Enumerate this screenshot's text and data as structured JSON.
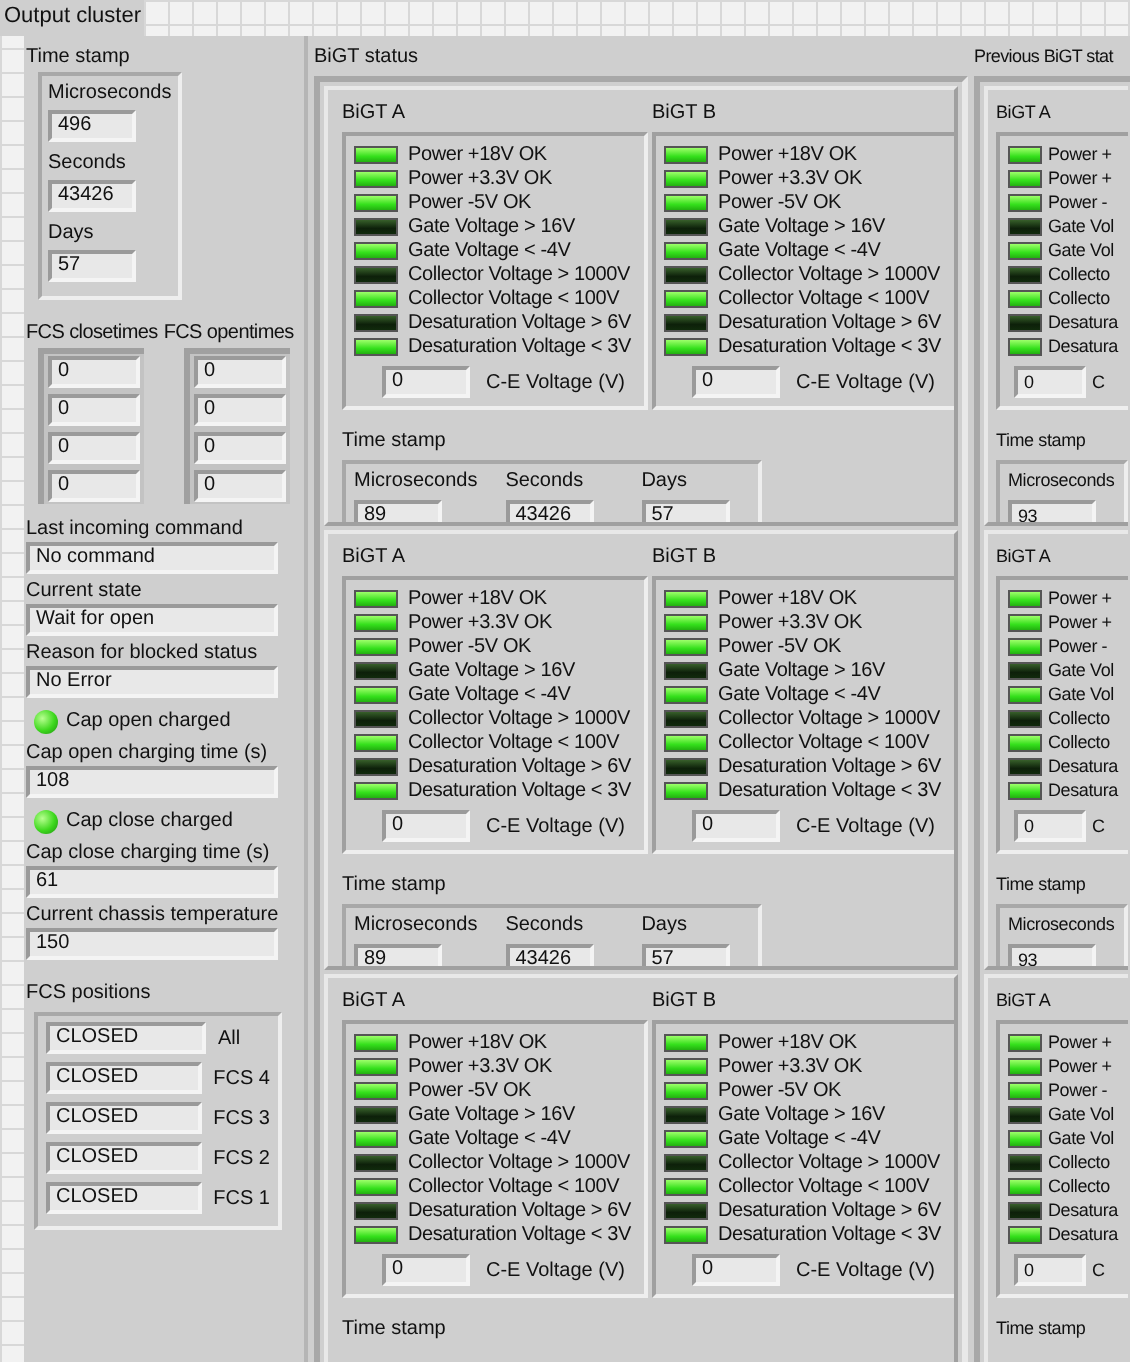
{
  "title": "Output cluster",
  "left": {
    "time_stamp": {
      "label": "Time stamp",
      "fields": [
        {
          "label": "Microseconds",
          "value": "496"
        },
        {
          "label": "Seconds",
          "value": "43426"
        },
        {
          "label": "Days",
          "value": "57"
        }
      ]
    },
    "arrays": [
      {
        "label": "FCS closetimes",
        "values": [
          "0",
          "0",
          "0",
          "0"
        ]
      },
      {
        "label": "FCS opentimes",
        "values": [
          "0",
          "0",
          "0",
          "0"
        ]
      }
    ],
    "indicators": [
      {
        "kind": "field",
        "label": "Last incoming command",
        "value": "No command"
      },
      {
        "kind": "field",
        "label": "Current state",
        "value": "Wait for open"
      },
      {
        "kind": "field",
        "label": "Reason for blocked status",
        "value": "No Error"
      },
      {
        "kind": "led",
        "label": "Cap open charged",
        "on": true
      },
      {
        "kind": "field",
        "label": "Cap open charging time (s)",
        "value": "108"
      },
      {
        "kind": "led",
        "label": "Cap close charged",
        "on": true
      },
      {
        "kind": "field",
        "label": "Cap close charging time (s)",
        "value": "61"
      },
      {
        "kind": "field",
        "label": "Current chassis temperature",
        "value": "150"
      }
    ],
    "fcs_positions": {
      "label": "FCS positions",
      "rows": [
        {
          "value": "CLOSED",
          "label": "All"
        },
        {
          "value": "CLOSED",
          "label": "FCS 4"
        },
        {
          "value": "CLOSED",
          "label": "FCS 3"
        },
        {
          "value": "CLOSED",
          "label": "FCS 2"
        },
        {
          "value": "CLOSED",
          "label": "FCS 1"
        }
      ]
    }
  },
  "bigt_status": {
    "title": "BiGT status",
    "blocks": [
      {
        "units": [
          {
            "title": "BiGT A",
            "leds": [
              {
                "label": "Power +18V OK",
                "on": true
              },
              {
                "label": "Power +3.3V OK",
                "on": true
              },
              {
                "label": "Power -5V OK",
                "on": true
              },
              {
                "label": "Gate Voltage > 16V",
                "on": false
              },
              {
                "label": "Gate Voltage < -4V",
                "on": true
              },
              {
                "label": "Collector Voltage > 1000V",
                "on": false
              },
              {
                "label": "Collector Voltage < 100V",
                "on": true
              },
              {
                "label": "Desaturation Voltage > 6V",
                "on": false
              },
              {
                "label": "Desaturation Voltage < 3V",
                "on": true
              }
            ],
            "ce_voltage": {
              "value": "0",
              "label": "C-E Voltage (V)"
            }
          },
          {
            "title": "BiGT B",
            "leds": [
              {
                "label": "Power +18V OK",
                "on": true
              },
              {
                "label": "Power +3.3V OK",
                "on": true
              },
              {
                "label": "Power -5V OK",
                "on": true
              },
              {
                "label": "Gate Voltage > 16V",
                "on": false
              },
              {
                "label": "Gate Voltage < -4V",
                "on": true
              },
              {
                "label": "Collector Voltage > 1000V",
                "on": false
              },
              {
                "label": "Collector Voltage < 100V",
                "on": true
              },
              {
                "label": "Desaturation Voltage > 6V",
                "on": false
              },
              {
                "label": "Desaturation Voltage < 3V",
                "on": true
              }
            ],
            "ce_voltage": {
              "value": "0",
              "label": "C-E Voltage (V)"
            }
          }
        ],
        "time_stamp": {
          "label": "Time stamp",
          "fields": [
            {
              "label": "Microseconds",
              "value": "89"
            },
            {
              "label": "Seconds",
              "value": "43426"
            },
            {
              "label": "Days",
              "value": "57"
            }
          ]
        }
      },
      {
        "units": [
          {
            "title": "BiGT A",
            "leds": [
              {
                "label": "Power +18V OK",
                "on": true
              },
              {
                "label": "Power +3.3V OK",
                "on": true
              },
              {
                "label": "Power -5V OK",
                "on": true
              },
              {
                "label": "Gate Voltage > 16V",
                "on": false
              },
              {
                "label": "Gate Voltage < -4V",
                "on": true
              },
              {
                "label": "Collector Voltage > 1000V",
                "on": false
              },
              {
                "label": "Collector Voltage < 100V",
                "on": true
              },
              {
                "label": "Desaturation Voltage > 6V",
                "on": false
              },
              {
                "label": "Desaturation Voltage < 3V",
                "on": true
              }
            ],
            "ce_voltage": {
              "value": "0",
              "label": "C-E Voltage (V)"
            }
          },
          {
            "title": "BiGT B",
            "leds": [
              {
                "label": "Power +18V OK",
                "on": true
              },
              {
                "label": "Power +3.3V OK",
                "on": true
              },
              {
                "label": "Power -5V OK",
                "on": true
              },
              {
                "label": "Gate Voltage > 16V",
                "on": false
              },
              {
                "label": "Gate Voltage < -4V",
                "on": true
              },
              {
                "label": "Collector Voltage > 1000V",
                "on": false
              },
              {
                "label": "Collector Voltage < 100V",
                "on": true
              },
              {
                "label": "Desaturation Voltage > 6V",
                "on": false
              },
              {
                "label": "Desaturation Voltage < 3V",
                "on": true
              }
            ],
            "ce_voltage": {
              "value": "0",
              "label": "C-E Voltage (V)"
            }
          }
        ],
        "time_stamp": {
          "label": "Time stamp",
          "fields": [
            {
              "label": "Microseconds",
              "value": "89"
            },
            {
              "label": "Seconds",
              "value": "43426"
            },
            {
              "label": "Days",
              "value": "57"
            }
          ]
        }
      },
      {
        "units": [
          {
            "title": "BiGT A",
            "leds": [
              {
                "label": "Power +18V OK",
                "on": true
              },
              {
                "label": "Power +3.3V OK",
                "on": true
              },
              {
                "label": "Power -5V OK",
                "on": true
              },
              {
                "label": "Gate Voltage > 16V",
                "on": false
              },
              {
                "label": "Gate Voltage < -4V",
                "on": true
              },
              {
                "label": "Collector Voltage > 1000V",
                "on": false
              },
              {
                "label": "Collector Voltage < 100V",
                "on": true
              },
              {
                "label": "Desaturation Voltage > 6V",
                "on": false
              },
              {
                "label": "Desaturation Voltage < 3V",
                "on": true
              }
            ],
            "ce_voltage": {
              "value": "0",
              "label": "C-E Voltage (V)"
            }
          },
          {
            "title": "BiGT B",
            "leds": [
              {
                "label": "Power +18V OK",
                "on": true
              },
              {
                "label": "Power +3.3V OK",
                "on": true
              },
              {
                "label": "Power -5V OK",
                "on": true
              },
              {
                "label": "Gate Voltage > 16V",
                "on": false
              },
              {
                "label": "Gate Voltage < -4V",
                "on": true
              },
              {
                "label": "Collector Voltage > 1000V",
                "on": false
              },
              {
                "label": "Collector Voltage < 100V",
                "on": true
              },
              {
                "label": "Desaturation Voltage > 6V",
                "on": false
              },
              {
                "label": "Desaturation Voltage < 3V",
                "on": true
              }
            ],
            "ce_voltage": {
              "value": "0",
              "label": "C-E Voltage (V)"
            }
          }
        ],
        "time_stamp": {
          "label": "Time stamp"
        }
      }
    ]
  },
  "previous_bigt_status": {
    "title": "Previous BiGT stat",
    "blocks": [
      {
        "units": [
          {
            "title": "BiGT A",
            "leds": [
              {
                "label": "Power +",
                "on": true
              },
              {
                "label": "Power +",
                "on": true
              },
              {
                "label": "Power -",
                "on": true
              },
              {
                "label": "Gate Vol",
                "on": false
              },
              {
                "label": "Gate Vol",
                "on": true
              },
              {
                "label": "Collecto",
                "on": false
              },
              {
                "label": "Collecto",
                "on": true
              },
              {
                "label": "Desatura",
                "on": false
              },
              {
                "label": "Desatura",
                "on": true
              }
            ],
            "ce_voltage": {
              "value": "0",
              "label": "C"
            }
          }
        ],
        "time_stamp": {
          "label": "Time stamp",
          "fields": [
            {
              "label": "Microseconds",
              "value": "93"
            }
          ]
        }
      },
      {
        "units": [
          {
            "title": "BiGT A",
            "leds": [
              {
                "label": "Power +",
                "on": true
              },
              {
                "label": "Power +",
                "on": true
              },
              {
                "label": "Power -",
                "on": true
              },
              {
                "label": "Gate Vol",
                "on": false
              },
              {
                "label": "Gate Vol",
                "on": true
              },
              {
                "label": "Collecto",
                "on": false
              },
              {
                "label": "Collecto",
                "on": true
              },
              {
                "label": "Desatura",
                "on": false
              },
              {
                "label": "Desatura",
                "on": true
              }
            ],
            "ce_voltage": {
              "value": "0",
              "label": "C"
            }
          }
        ],
        "time_stamp": {
          "label": "Time stamp",
          "fields": [
            {
              "label": "Microseconds",
              "value": "93"
            }
          ]
        }
      },
      {
        "units": [
          {
            "title": "BiGT A",
            "leds": [
              {
                "label": "Power +",
                "on": true
              },
              {
                "label": "Power +",
                "on": true
              },
              {
                "label": "Power -",
                "on": true
              },
              {
                "label": "Gate Vol",
                "on": false
              },
              {
                "label": "Gate Vol",
                "on": true
              },
              {
                "label": "Collecto",
                "on": false
              },
              {
                "label": "Collecto",
                "on": true
              },
              {
                "label": "Desatura",
                "on": false
              },
              {
                "label": "Desatura",
                "on": true
              }
            ],
            "ce_voltage": {
              "value": "0",
              "label": "C"
            }
          }
        ],
        "time_stamp": {
          "label": "Time stamp"
        }
      }
    ]
  }
}
